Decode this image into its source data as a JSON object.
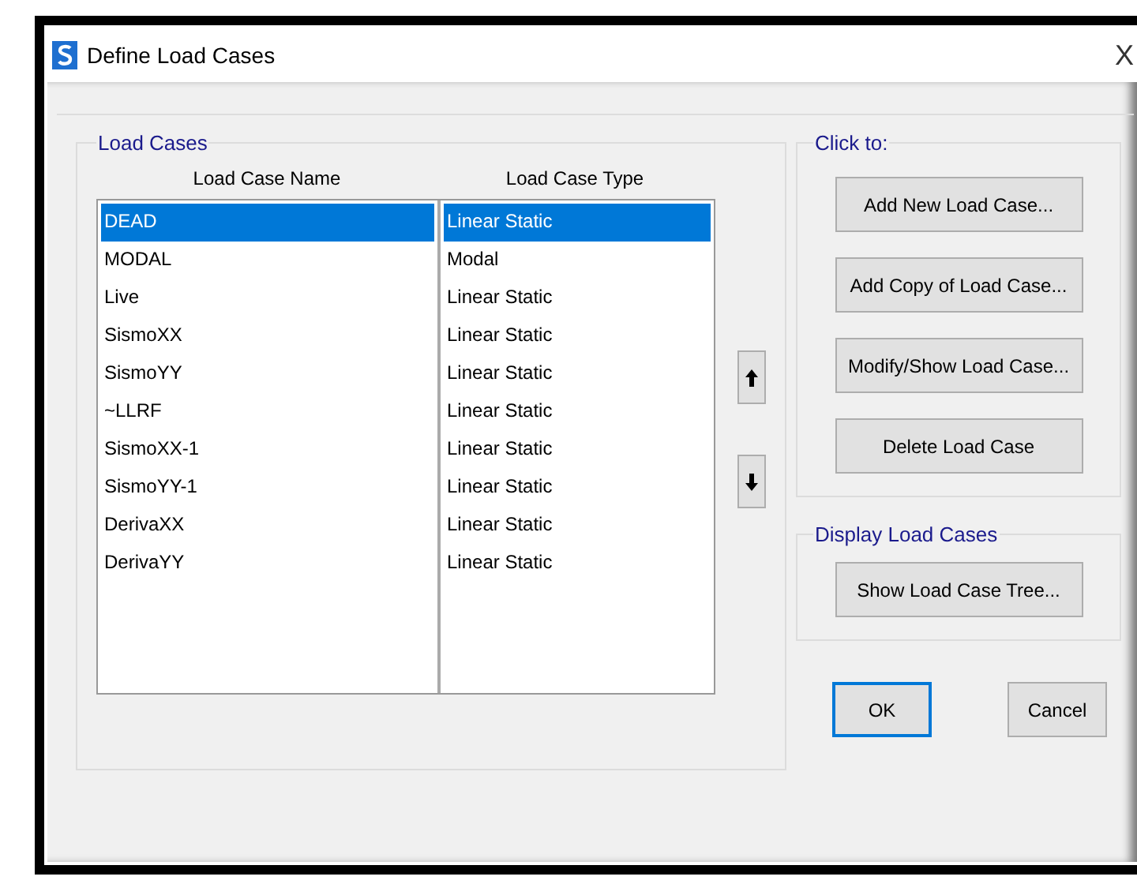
{
  "window": {
    "title": "Define Load Cases",
    "close": "X"
  },
  "load_cases": {
    "title": "Load Cases",
    "columns": [
      "Load Case Name",
      "Load Case Type"
    ],
    "rows": [
      {
        "name": "DEAD",
        "type": "Linear Static",
        "selected": true
      },
      {
        "name": "MODAL",
        "type": "Modal",
        "selected": false
      },
      {
        "name": "Live",
        "type": "Linear Static",
        "selected": false
      },
      {
        "name": "SismoXX",
        "type": "Linear Static",
        "selected": false
      },
      {
        "name": "SismoYY",
        "type": "Linear Static",
        "selected": false
      },
      {
        "name": "~LLRF",
        "type": "Linear Static",
        "selected": false
      },
      {
        "name": "SismoXX-1",
        "type": "Linear Static",
        "selected": false
      },
      {
        "name": "SismoYY-1",
        "type": "Linear Static",
        "selected": false
      },
      {
        "name": "DerivaXX",
        "type": "Linear Static",
        "selected": false
      },
      {
        "name": "DerivaYY",
        "type": "Linear Static",
        "selected": false
      }
    ]
  },
  "click_to": {
    "title": "Click to:",
    "buttons": [
      "Add New Load Case...",
      "Add Copy of Load Case...",
      "Modify/Show Load Case...",
      "Delete Load Case"
    ]
  },
  "display": {
    "title": "Display Load Cases",
    "buttons": [
      "Show Load Case Tree..."
    ]
  },
  "footer_buttons": [
    {
      "label": "OK",
      "default": true
    },
    {
      "label": "Cancel",
      "default": false
    }
  ]
}
